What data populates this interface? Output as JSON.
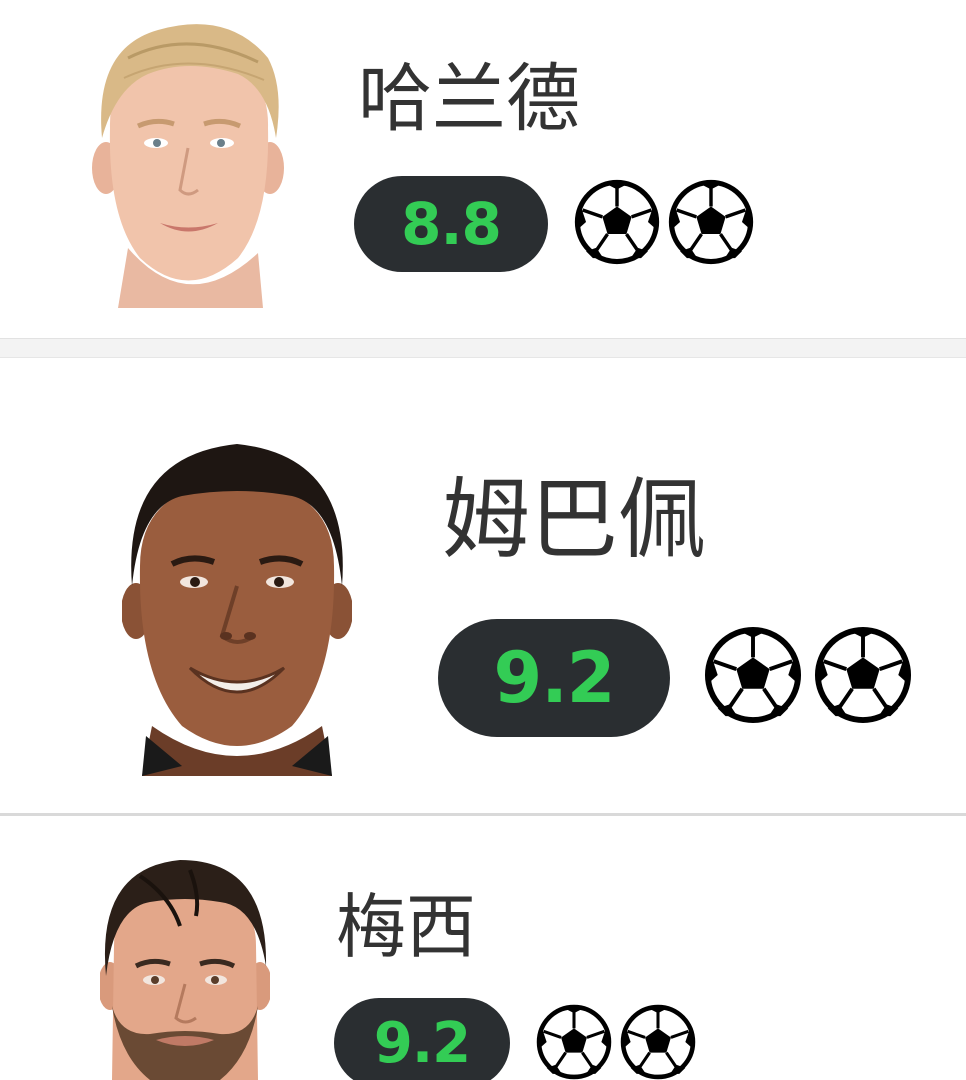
{
  "players": [
    {
      "name": "哈兰德",
      "rating": "8.8",
      "goals": 2,
      "avatar_icon": "player-face-blond"
    },
    {
      "name": "姆巴佩",
      "rating": "9.2",
      "goals": 2,
      "avatar_icon": "player-face-dark"
    },
    {
      "name": "梅西",
      "rating": "9.2",
      "goals": 2,
      "avatar_icon": "player-face-bearded"
    }
  ],
  "colors": {
    "rating_bg": "#2a2e31",
    "rating_text": "#33cc55",
    "name_text": "#333333",
    "divider": "#f3f3f3"
  },
  "goal_icon": "soccer-ball-icon"
}
